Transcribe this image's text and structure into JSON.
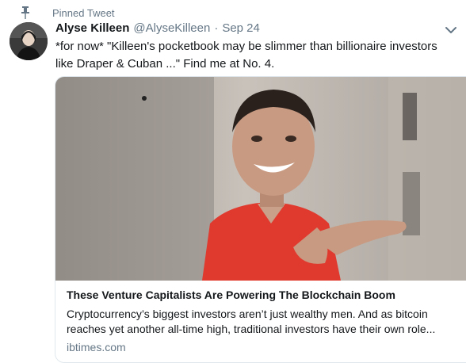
{
  "pinned": {
    "label": "Pinned Tweet",
    "icon": "pin-icon"
  },
  "tweet": {
    "name": "Alyse Killeen",
    "handle": "@AlyseKilleen",
    "separator": "·",
    "date": "Sep 24",
    "text": "*for now* \"Killeen's pocketbook may be slimmer than billionaire investors like Draper & Cuban ...\" Find me at No. 4."
  },
  "card": {
    "title": "These Venture Capitalists Are Powering The Blockchain Boom",
    "description": "Cryptocurrency’s biggest investors aren’t just wealthy men. And as bitcoin reaches yet another all-time high, traditional investors have their own role...",
    "domain": "ibtimes.com"
  },
  "colors": {
    "text": "#14171a",
    "secondary": "#657786",
    "border": "#e1e8ed",
    "shirt": "#e03a2f"
  }
}
